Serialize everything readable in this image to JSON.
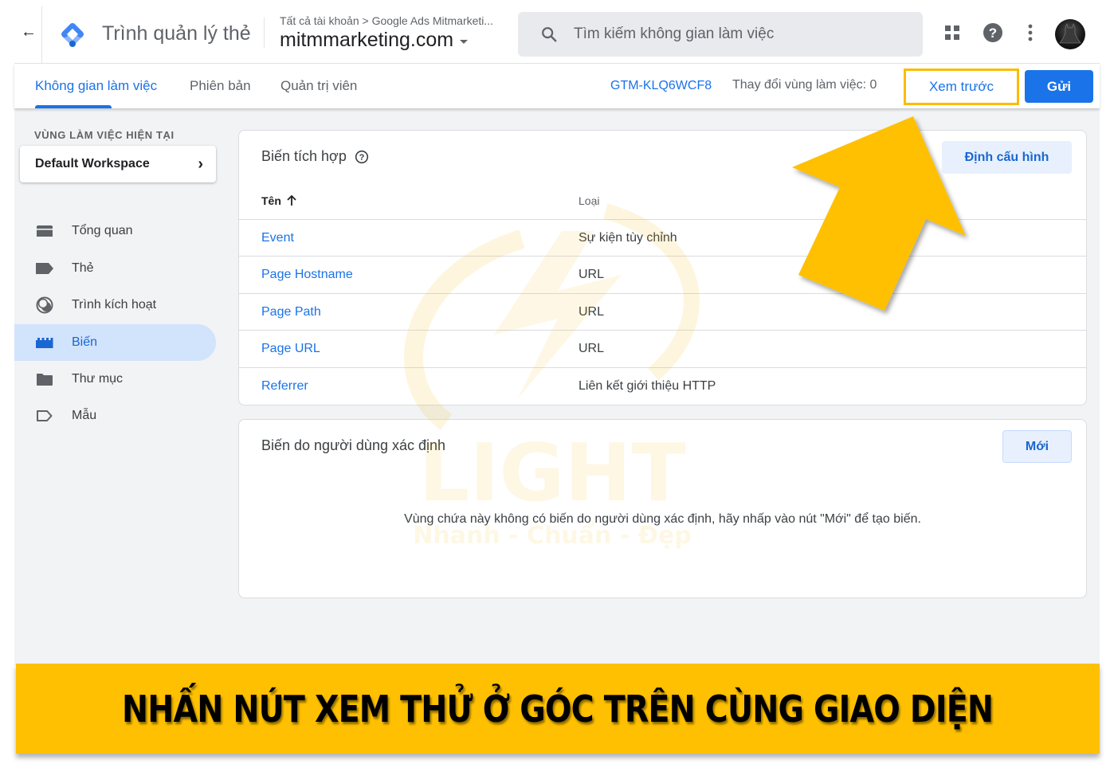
{
  "header": {
    "back_icon": "arrow-left-icon",
    "app_logo": "tag-manager-logo",
    "app_title": "Trình quản lý thẻ",
    "breadcrumb": "Tất cả tài khoản > Google Ads Mitmarketi...",
    "container_name": "mitmmarketing.com",
    "search_placeholder": "Tìm kiếm không gian làm việc",
    "icons": [
      "apps-grid-icon",
      "help-icon",
      "more-vert-icon",
      "account-avatar"
    ]
  },
  "tabs": {
    "items": [
      {
        "label": "Không gian làm việc",
        "active": true
      },
      {
        "label": "Phiên bản",
        "active": false
      },
      {
        "label": "Quản trị viên",
        "active": false
      }
    ],
    "container_id": "GTM-KLQ6WCF8",
    "workspace_changes": "Thay đổi vùng làm việc: 0",
    "preview_label": "Xem trước",
    "submit_label": "Gửi"
  },
  "sidebar": {
    "workspace_section_label": "VÙNG LÀM VIỆC HIỆN TẠI",
    "workspace_name": "Default Workspace",
    "items": [
      {
        "label": "Tổng quan",
        "icon": "overview-icon",
        "active": false
      },
      {
        "label": "Thẻ",
        "icon": "tag-icon",
        "active": false
      },
      {
        "label": "Trình kích hoạt",
        "icon": "trigger-icon",
        "active": false
      },
      {
        "label": "Biến",
        "icon": "variable-icon",
        "active": true
      },
      {
        "label": "Thư mục",
        "icon": "folder-icon",
        "active": false
      },
      {
        "label": "Mẫu",
        "icon": "template-icon",
        "active": false
      }
    ]
  },
  "builtin_variables": {
    "title": "Biến tích hợp",
    "configure_label": "Định cấu hình",
    "columns": {
      "name": "Tên",
      "type": "Loại"
    },
    "sort_icon": "arrow-up-icon",
    "rows": [
      {
        "name": "Event",
        "type": "Sự kiện tùy chỉnh"
      },
      {
        "name": "Page Hostname",
        "type": "URL"
      },
      {
        "name": "Page Path",
        "type": "URL"
      },
      {
        "name": "Page URL",
        "type": "URL"
      },
      {
        "name": "Referrer",
        "type": "Liên kết giới thiệu HTTP"
      }
    ]
  },
  "user_variables": {
    "title": "Biến do người dùng xác định",
    "new_label": "Mới",
    "empty_message": "Vùng chứa này không có biến do người dùng xác định, hãy nhấp vào nút \"Mới\" để tạo biến."
  },
  "watermark": {
    "brand": "LIGHT",
    "tagline": "Nhanh - Chuẩn - Đẹp"
  },
  "annotation": {
    "caption": "NHẤN NÚT XEM THỬ Ở GÓC TRÊN CÙNG GIAO DIỆN",
    "arrow_icon": "pointer-arrow",
    "highlight_color": "#fbbc04",
    "banner_color": "#fec000"
  },
  "colors": {
    "primary": "#1a73e8",
    "active_nav_bg": "#d2e3fc",
    "surface": "#f1f3f4"
  }
}
